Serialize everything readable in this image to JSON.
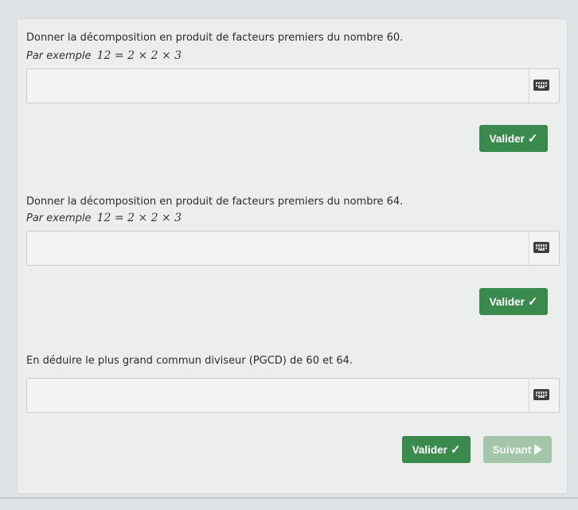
{
  "section1": {
    "question": "Donner la décomposition en produit de facteurs premiers du nombre 60.",
    "example_label": "Par exemple",
    "example_math": "12 = 2 × 2 × 3",
    "answer_value": "",
    "validate_label": "Valider"
  },
  "section2": {
    "question": "Donner la décomposition en produit de facteurs premiers du nombre 64.",
    "example_label": "Par exemple",
    "example_math": "12 = 2 × 2 × 3",
    "answer_value": "",
    "validate_label": "Valider"
  },
  "section3": {
    "question": "En déduire le plus grand commun diviseur (PGCD) de 60 et 64.",
    "answer_value": "",
    "validate_label": "Valider",
    "next_label": "Suivant"
  },
  "icons": {
    "check": "check-icon",
    "keyboard": "keyboard-icon",
    "next": "play-icon"
  },
  "colors": {
    "validate_button": "#3a8a4e",
    "next_button": "#a3c6aa",
    "background": "#eceeed"
  }
}
